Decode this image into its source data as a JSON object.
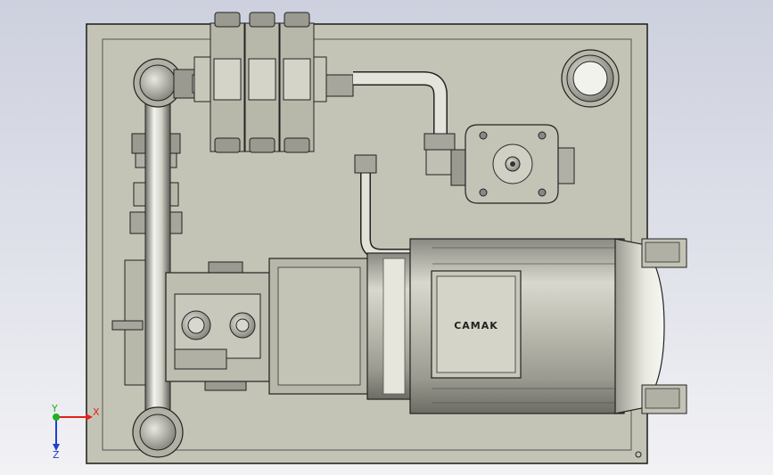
{
  "viewport": {
    "background": [
      "#cdd0de",
      "#f2f2f5"
    ]
  },
  "model": {
    "motor_nameplate": "CAMAK",
    "components": [
      "base-plate",
      "solenoid-valve",
      "pipe",
      "gear-pump",
      "electric-motor",
      "filler-cap",
      "flange-filter"
    ]
  },
  "triad": {
    "x_label": "X",
    "y_label": "Y",
    "z_label": "Z",
    "x_color": "#e02020",
    "y_color": "#20b020",
    "z_color": "#2040d0"
  },
  "colors": {
    "body": "#c4c4b6",
    "outline": "#1a1a1a",
    "steel": "#8a8a88"
  }
}
